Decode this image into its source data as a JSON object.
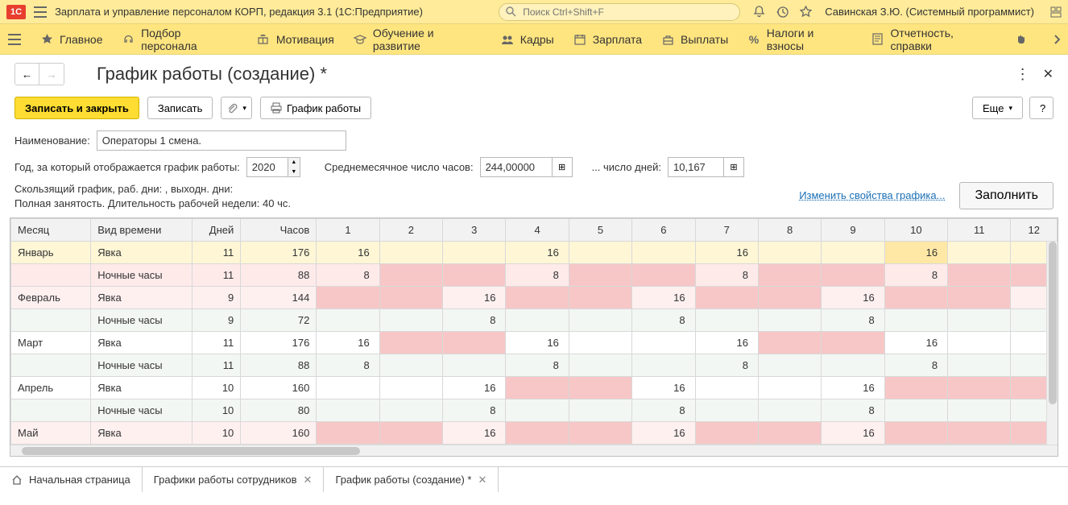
{
  "app": {
    "title": "Зарплата и управление персоналом КОРП, редакция 3.1  (1С:Предприятие)",
    "search_placeholder": "Поиск Ctrl+Shift+F",
    "user": "Савинская З.Ю. (Системный программист)"
  },
  "menu": {
    "items": [
      {
        "label": "Главное"
      },
      {
        "label": "Подбор персонала"
      },
      {
        "label": "Мотивация"
      },
      {
        "label": "Обучение и развитие"
      },
      {
        "label": "Кадры"
      },
      {
        "label": "Зарплата"
      },
      {
        "label": "Выплаты"
      },
      {
        "label": "Налоги и взносы"
      },
      {
        "label": "Отчетность, справки"
      }
    ]
  },
  "page": {
    "title": "График работы (создание) *"
  },
  "toolbar": {
    "save_close": "Записать и закрыть",
    "save": "Записать",
    "print_schedule": "График работы",
    "more": "Еще",
    "help": "?"
  },
  "form": {
    "name_label": "Наименование:",
    "name_value": "Операторы 1 смена.",
    "year_label": "Год, за который отображается график работы:",
    "year_value": "2020",
    "avg_hours_label": "Среднемесячное число часов:",
    "avg_hours_value": "244,00000",
    "avg_days_label": "... число дней:",
    "avg_days_value": "10,167",
    "desc_line1": "Скользящий график, раб. дни: , выходн. дни:",
    "desc_line2": "Полная занятость. Длительность рабочей недели: 40 чс.",
    "change_link": "Изменить свойства графика...",
    "fill_btn": "Заполнить"
  },
  "table": {
    "headers": {
      "month": "Месяц",
      "type": "Вид времени",
      "days": "Дней",
      "hours": "Часов",
      "d1": "1",
      "d2": "2",
      "d3": "3",
      "d4": "4",
      "d5": "5",
      "d6": "6",
      "d7": "7",
      "d8": "8",
      "d9": "9",
      "d10": "10",
      "d11": "11",
      "d12": "12"
    },
    "rows": [
      {
        "month": "Январь",
        "type": "Явка",
        "days": "11",
        "hours": "176",
        "cells": {
          "1": "16",
          "4": "16",
          "7": "16",
          "10": "16"
        },
        "sel": true,
        "hl": "10",
        "pinks": []
      },
      {
        "month": "",
        "type": "Ночные часы",
        "days": "11",
        "hours": "88",
        "cells": {
          "1": "8",
          "4": "8",
          "7": "8",
          "10": "8"
        },
        "cls": "r1alt",
        "pinks": [
          "2",
          "3",
          "5",
          "6",
          "8",
          "9",
          "11",
          "12"
        ]
      },
      {
        "month": "Февраль",
        "type": "Явка",
        "days": "9",
        "hours": "144",
        "cells": {
          "3": "16",
          "6": "16",
          "9": "16"
        },
        "cls": "r1",
        "pinks": [
          "1",
          "2",
          "4",
          "5",
          "7",
          "8",
          "10",
          "11"
        ]
      },
      {
        "month": "",
        "type": "Ночные часы",
        "days": "9",
        "hours": "72",
        "cells": {
          "3": "8",
          "6": "8",
          "9": "8"
        },
        "cls": "r0alt",
        "pinks": []
      },
      {
        "month": "Март",
        "type": "Явка",
        "days": "11",
        "hours": "176",
        "cells": {
          "1": "16",
          "4": "16",
          "7": "16",
          "10": "16"
        },
        "cls": "r0",
        "pinks": [
          "2",
          "3",
          "8",
          "9"
        ]
      },
      {
        "month": "",
        "type": "Ночные часы",
        "days": "11",
        "hours": "88",
        "cells": {
          "1": "8",
          "4": "8",
          "7": "8",
          "10": "8"
        },
        "cls": "r0alt",
        "pinks": []
      },
      {
        "month": "Апрель",
        "type": "Явка",
        "days": "10",
        "hours": "160",
        "cells": {
          "3": "16",
          "6": "16",
          "9": "16"
        },
        "cls": "r0",
        "pinks": [
          "4",
          "5",
          "10",
          "11",
          "12"
        ]
      },
      {
        "month": "",
        "type": "Ночные часы",
        "days": "10",
        "hours": "80",
        "cells": {
          "3": "8",
          "6": "8",
          "9": "8"
        },
        "cls": "r0alt",
        "pinks": []
      },
      {
        "month": "Май",
        "type": "Явка",
        "days": "10",
        "hours": "160",
        "cells": {
          "3": "16",
          "6": "16",
          "9": "16"
        },
        "cls": "r1",
        "pinks": [
          "1",
          "2",
          "4",
          "5",
          "7",
          "8",
          "10",
          "11",
          "12"
        ]
      }
    ]
  },
  "tabs": {
    "home": "Начальная страница",
    "t1": "Графики работы сотрудников",
    "t2": "График работы (создание) *"
  }
}
